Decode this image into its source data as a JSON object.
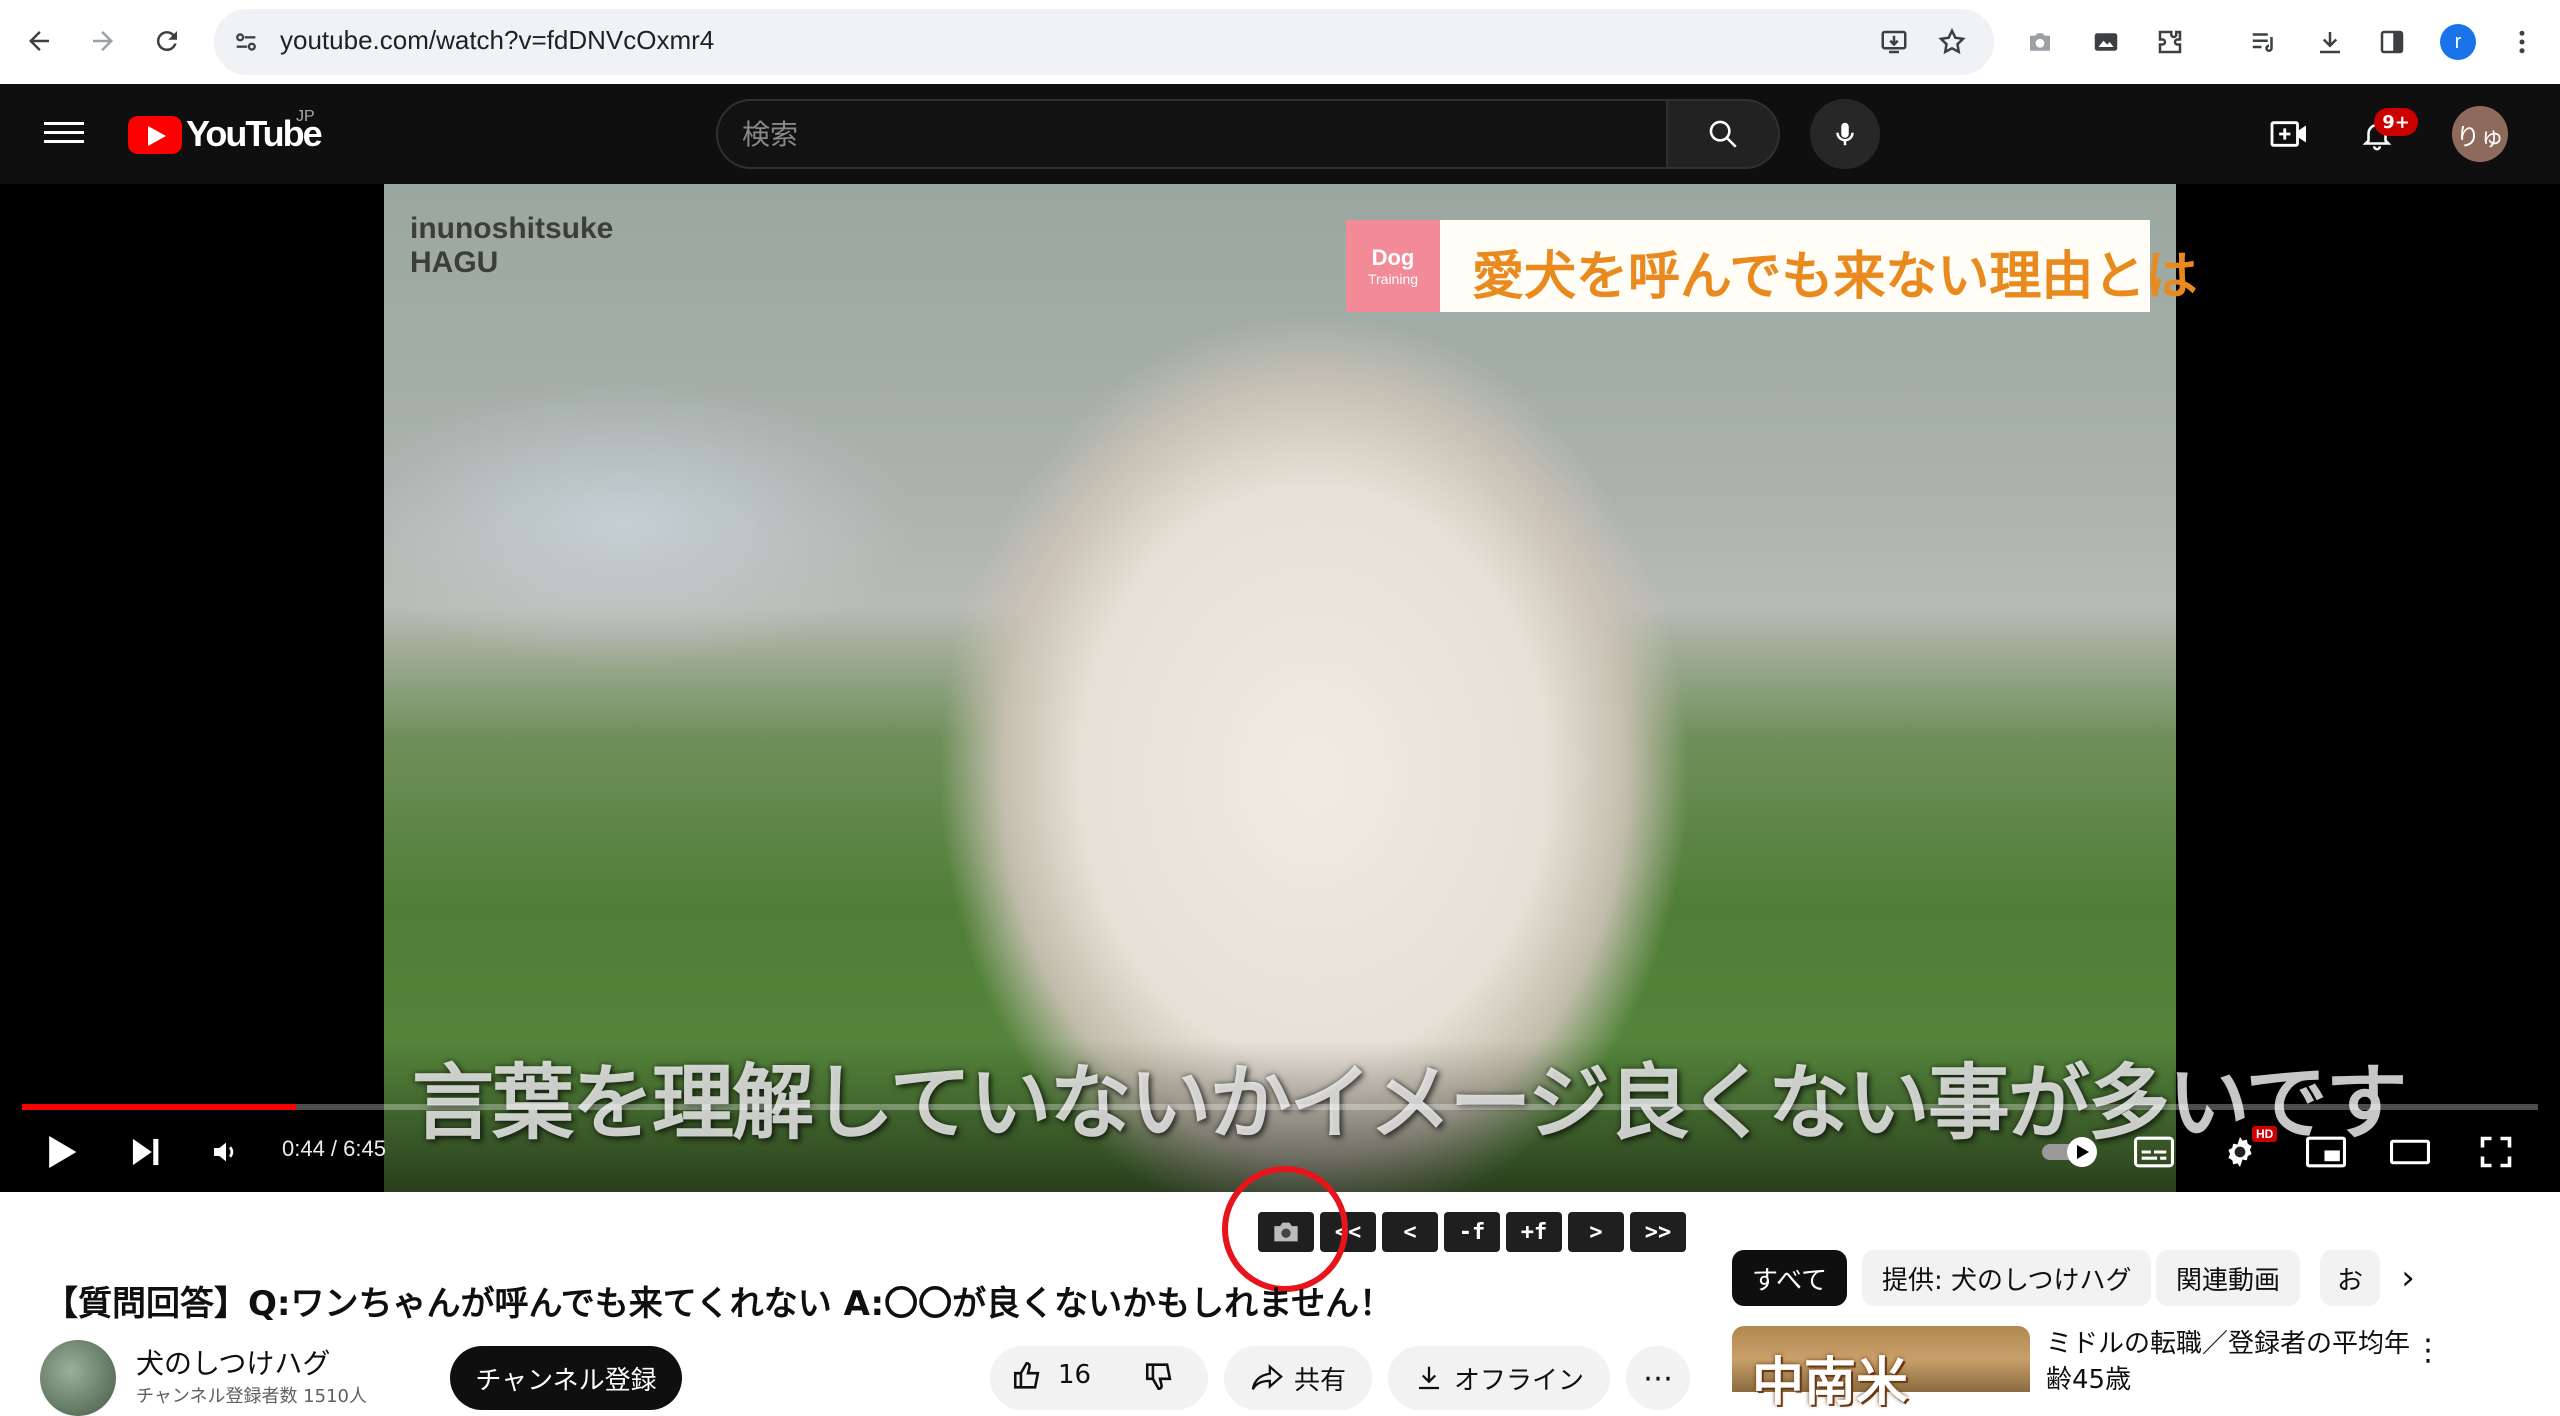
{
  "browser": {
    "url": "youtube.com/watch?v=fdDNVcOxmr4",
    "profile_initial": "r"
  },
  "header": {
    "logo_text": "YouTube",
    "region": "JP",
    "search_placeholder": "検索",
    "notification_count": "9+",
    "avatar_text": "りゅ"
  },
  "video": {
    "watermark_line1": "inunoshitsuke",
    "watermark_line2": "HAGU",
    "tag_main": "Dog",
    "tag_sub": "Training",
    "banner_text": "愛犬を呼んでも来ない理由とは",
    "subtitle": "言葉を理解していないかイメージ良くない事が多いです"
  },
  "player": {
    "current_time": "0:44",
    "duration": "6:45",
    "time_display": "0:44 / 6:45",
    "progress_fraction": 0.109,
    "hd_badge": "HD"
  },
  "frame_toolbar": {
    "buttons": [
      "<<",
      "<",
      "-f",
      "+f",
      ">",
      ">>"
    ]
  },
  "info": {
    "title": "【質問回答】Q:ワンちゃんが呼んでも来てくれない A:〇〇が良くないかもしれません！",
    "channel_name": "犬のしつけハグ",
    "channel_sub": "チャンネル登録者数 1510人",
    "subscribe_label": "チャンネル登録",
    "like_count": "16",
    "share_label": "共有",
    "offline_label": "オフライン",
    "more_label": "⋯"
  },
  "sidebar": {
    "chips": [
      "すべて",
      "提供: 犬のしつけハグ",
      "関連動画",
      "お"
    ],
    "rec_thumb_text": "中南米",
    "rec_title": "ミドルの転職／登録者の平均年齢45歳"
  },
  "colors": {
    "accent_red": "#ff0000",
    "highlight_ring": "#e8141c",
    "banner_orange": "#e98a1f",
    "tag_pink": "#f28b97"
  }
}
